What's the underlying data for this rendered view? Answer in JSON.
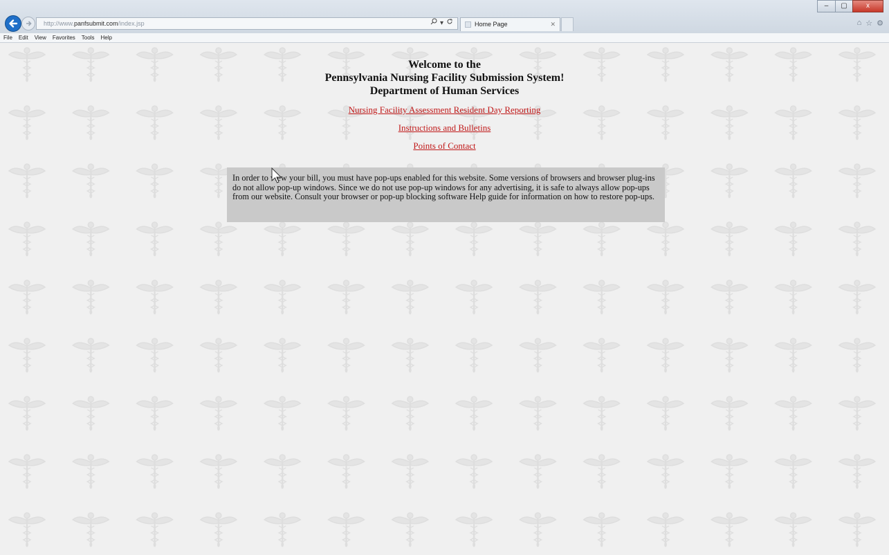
{
  "browser": {
    "url_prefix": "http://www.",
    "url_domain": "panfsubmit.com",
    "url_path": "/index.jsp",
    "tab_title": "Home Page",
    "window_controls": {
      "minimize": "–",
      "maximize": "▢",
      "close": "x"
    },
    "icons": [
      "back-arrow-icon",
      "forward-arrow-icon",
      "search-icon",
      "refresh-icon",
      "home-icon",
      "favorites-star-icon",
      "settings-gear-icon"
    ]
  },
  "menu": {
    "items": [
      "File",
      "Edit",
      "View",
      "Favorites",
      "Tools",
      "Help"
    ]
  },
  "page": {
    "title_lines": [
      "Welcome to the",
      "Pennsylvania Nursing Facility Submission System!",
      "Department of Human Services"
    ],
    "links": [
      "Nursing Facility Assessment Resident Day Reporting",
      "Instructions and Bulletins",
      "Points of Contact"
    ],
    "notice": "In order to view your bill, you must have pop-ups enabled for this website. Some versions of browsers and browser plug-ins do not allow pop-up windows. Since we do not use pop-up windows for any advertising, it is safe to always allow pop-ups from our website. Consult your browser or pop-up blocking software Help guide for information on how to restore pop-ups.",
    "background_motif": "caduceus-watermark",
    "link_color": "#c01818",
    "notice_bg": "#c9c9c9"
  }
}
